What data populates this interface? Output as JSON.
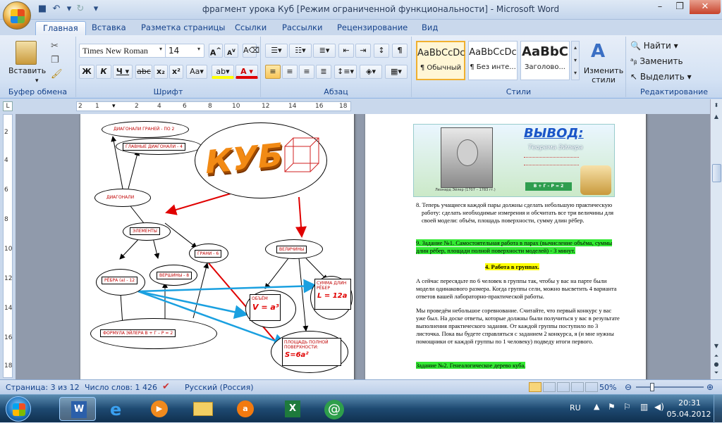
{
  "window": {
    "title": "фрагмент урока Куб [Режим ограниченной функциональности]  -  Microsoft Word"
  },
  "tabs": [
    "Главная",
    "Вставка",
    "Разметка страницы",
    "Ссылки",
    "Рассылки",
    "Рецензирование",
    "Вид"
  ],
  "ribbon": {
    "clipboard": {
      "paste": "Вставить",
      "label": "Буфер обмена"
    },
    "font": {
      "name": "Times New Roman",
      "size": "14",
      "label": "Шрифт"
    },
    "paragraph": {
      "label": "Абзац"
    },
    "styles": {
      "items": [
        {
          "sample": "AaBbCcDc",
          "name": "¶ Обычный"
        },
        {
          "sample": "AaBbCcDc",
          "name": "¶ Без инте..."
        },
        {
          "sample": "AaBbC",
          "name": "Заголово..."
        }
      ],
      "change": "Изменить стили",
      "label": "Стили"
    },
    "editing": {
      "find": "Найти",
      "replace": "Заменить",
      "select": "Выделить",
      "label": "Редактирование"
    }
  },
  "ruler": {
    "h": [
      "2",
      "1",
      "2",
      "4",
      "6",
      "8",
      "10",
      "12",
      "14",
      "16",
      "18"
    ],
    "v": [
      "2",
      "4",
      "6",
      "8",
      "10",
      "12",
      "14",
      "16",
      "18"
    ]
  },
  "diagram": {
    "cube_word": "КУБ",
    "n_face_diag": "ДИАГОНАЛИ ГРАНЕЙ  - ПО 2",
    "n_main_diag": "ГЛАВНЫЕ ДИАГОНАЛИ  - 4",
    "n_diag": "ДИАГОНАЛИ",
    "n_elements": "ЭЛЕМЕНТЫ",
    "n_faces": "ГРАНИ - 6",
    "n_quantities": "ВЕЛИЧИНЫ",
    "n_edges": "РЁБРА  (а) - 12",
    "n_vertices": "ВЕРШИНЫ - 8",
    "n_volume": "ОБЪЁМ",
    "f_volume": "V = a³",
    "n_sum": "СУММА ДЛИН РЁБЕР",
    "f_sum": "L = 12a",
    "n_euler": "ФОРМУЛА ЭЙЛЕРА   В + Г – Р = 2",
    "n_area": "ПЛОЩАДЬ ПОЛНОЙ ПОВЕРХНОСТИ:",
    "f_area": "S=6a²"
  },
  "banner": {
    "title": "ВЫВОД:",
    "subtitle": "Теорема Эйлера",
    "caption": "Леонард Эйлер (1707 – 1783 гг.)",
    "formula": "В + Г – Р = 2"
  },
  "page2": {
    "p8": "8.  Теперь учащиеся каждой пары должны сделать небольшую практическую работу: сделать необходимые измерения и обсчитать все три величины для своей модели: объём, площадь поверхности, сумму длин рёбер.",
    "p9": "9.  Задание №1. Самостоятельная работа в парах (вычисление  объёма, суммы длин рёбер, площади полной поверхности моделей) - 3 минут.",
    "p_head": "4.  Работа в группах.",
    "p_a": "А сейчас пересядьте по 6 человек в группы так, чтобы у вас на парте были модели одинакового размера. Когда группы сели, можно высветить 4 варианта ответов вашей лабораторно-практической работы.",
    "p_b": "Мы проведём небольшое соревнование. Считайте, что первый конкурс у вас уже был. На доске ответы, которые должны были получиться у вас в результате выполнения практического  задания. От каждой группы поступило по 3 листочка. Пока вы будете справляться с заданием 2 конкурса, я (и мне нужны помощники от каждой группы по 1 человеку) подведу итоги первого.",
    "p_task2": "Задание №2. Генеалогическое дерево куба."
  },
  "status": {
    "page": "Страница: 3 из 12",
    "words": "Число слов: 1 426",
    "lang": "Русский (Россия)",
    "zoom": "50%"
  },
  "taskbar": {
    "lang": "RU",
    "time": "20:31",
    "date": "05.04.2012"
  }
}
